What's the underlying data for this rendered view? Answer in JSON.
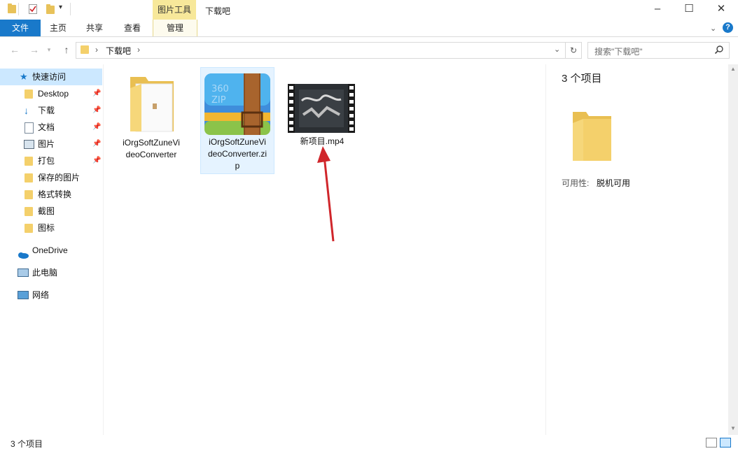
{
  "window": {
    "context_tab_title": "图片工具",
    "title": "下载吧"
  },
  "ribbon": {
    "tabs": [
      "文件",
      "主页",
      "共享",
      "查看",
      "管理"
    ]
  },
  "address": {
    "crumb": "下载吧"
  },
  "search": {
    "placeholder": "搜索\"下载吧\""
  },
  "sidebar": {
    "quick_access": "快速访问",
    "items": [
      "Desktop",
      "下载",
      "文档",
      "图片",
      "打包",
      "保存的图片",
      "格式转换",
      "截图",
      "图标"
    ],
    "onedrive": "OneDrive",
    "this_pc": "此电脑",
    "network": "网络"
  },
  "files": [
    {
      "name_line1": "iOrgSoftZuneVi",
      "name_line2": "deoConverter"
    },
    {
      "name_line1": "iOrgSoftZuneVi",
      "name_line2": "deoConverter.zi",
      "name_line3": "p",
      "thumb_text": "360\nZIP"
    },
    {
      "name_line1": "新项目.mp4"
    }
  ],
  "details": {
    "count": "3 个项目",
    "availability_label": "可用性:",
    "availability_value": "脱机可用"
  },
  "status": {
    "count": "3 个项目"
  },
  "colors": {
    "file_tab": "#1979ca",
    "context_tab": "#f7e89a",
    "selection": "#cce8ff",
    "folder": "#f4d06b",
    "annotation_arrow": "#d0262b"
  }
}
